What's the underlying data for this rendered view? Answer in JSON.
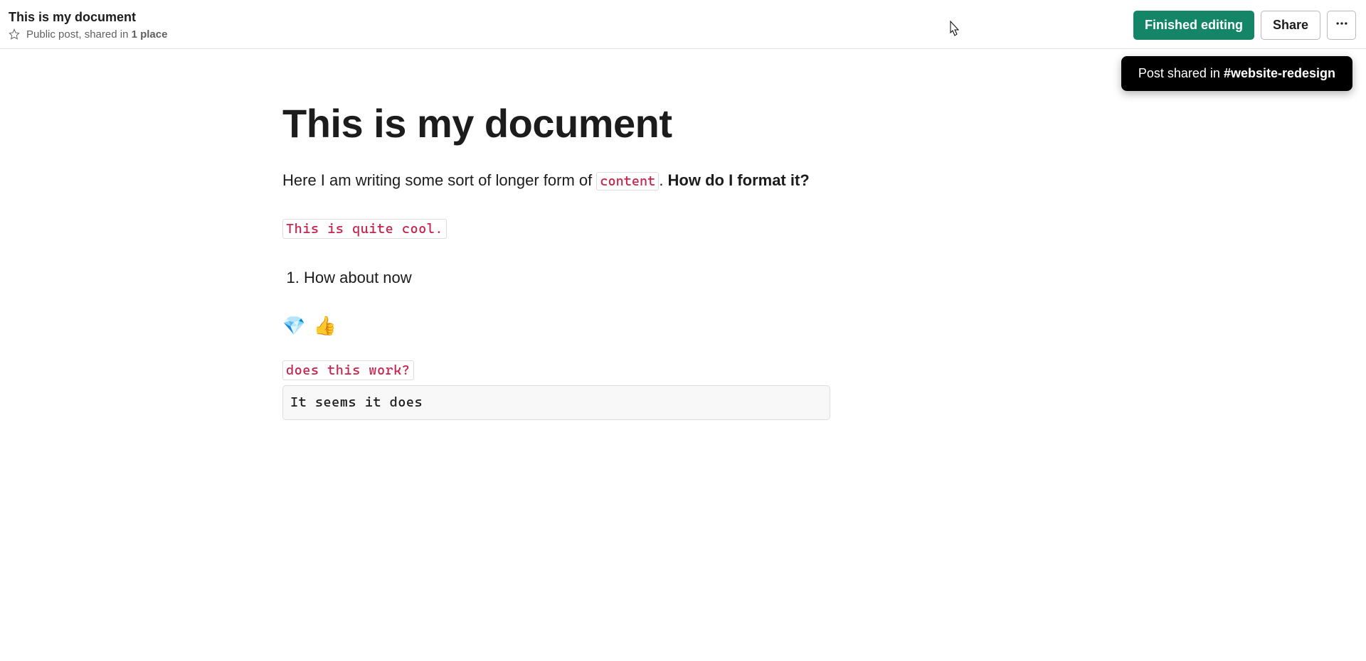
{
  "header": {
    "title": "This is my document",
    "meta_prefix": "Public post, shared in ",
    "meta_bold": "1 place",
    "finished_label": "Finished editing",
    "share_label": "Share"
  },
  "tooltip": {
    "prefix": "Post shared in ",
    "bold": "#website-redesign"
  },
  "doc": {
    "title": "This is my document",
    "para_prefix": "Here I am writing some sort of longer form of ",
    "para_code": "content",
    "para_mid": ". ",
    "para_bold": "How do I format it?",
    "code_standalone": "This is quite cool.",
    "list_item_1": "How about now",
    "emoji_1": "💎",
    "emoji_2": "👍",
    "code_label": "does this work?",
    "big_code": "It seems it does"
  }
}
